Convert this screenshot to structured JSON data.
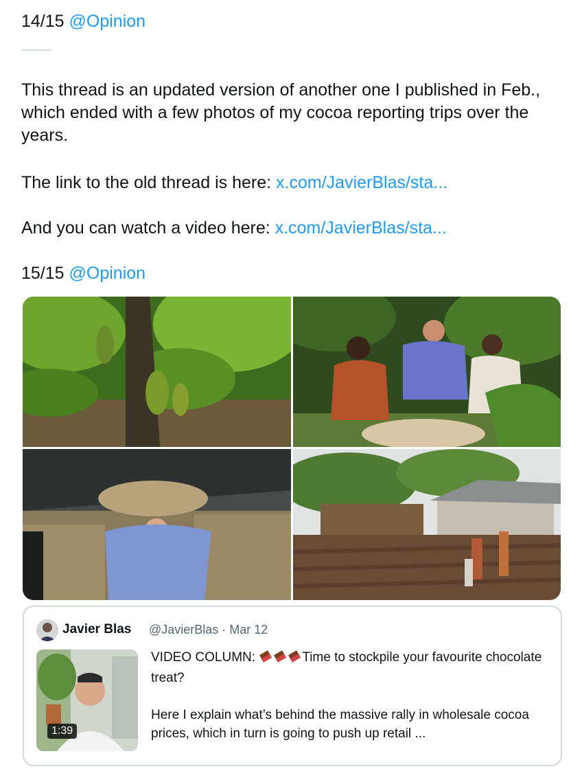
{
  "thread": {
    "part1": {
      "counter": "14/15",
      "mention": "@Opinion"
    },
    "body_text": "This thread is an updated version of another one I published in Feb., which ended with a few photos of my cocoa reporting trips over the years.",
    "old_thread": {
      "prefix": "The link to the old thread is here: ",
      "link": "x.com/JavierBlas/sta..."
    },
    "video": {
      "prefix": "And you can watch a video here: ",
      "link": "x.com/JavierBlas/sta..."
    },
    "part2": {
      "counter": "15/15",
      "mention": "@Opinion"
    }
  },
  "photos": [
    {
      "icon": "cocoa-tree-photo"
    },
    {
      "icon": "farmers-with-cocoa-beans-photo"
    },
    {
      "icon": "man-carrying-cocoa-sack-photo"
    },
    {
      "icon": "village-farm-photo"
    }
  ],
  "quote": {
    "author_name": "Javier Blas",
    "handle_date": "@JavierBlas · Mar 12",
    "line1_prefix": "VIDEO COLUMN: ",
    "line1_suffix": "Time to stockpile your favourite chocolate treat?",
    "line2": "Here I explain what’s behind the massive rally in wholesale cocoa prices, which in turn is going to push up retail ...",
    "video_duration": "1:39",
    "emoji_icon": "chocolate-bar-icon"
  },
  "colors": {
    "link": "#1d9bf0",
    "text": "#0f1419",
    "secondary": "#536471",
    "border": "#cfd9de"
  }
}
